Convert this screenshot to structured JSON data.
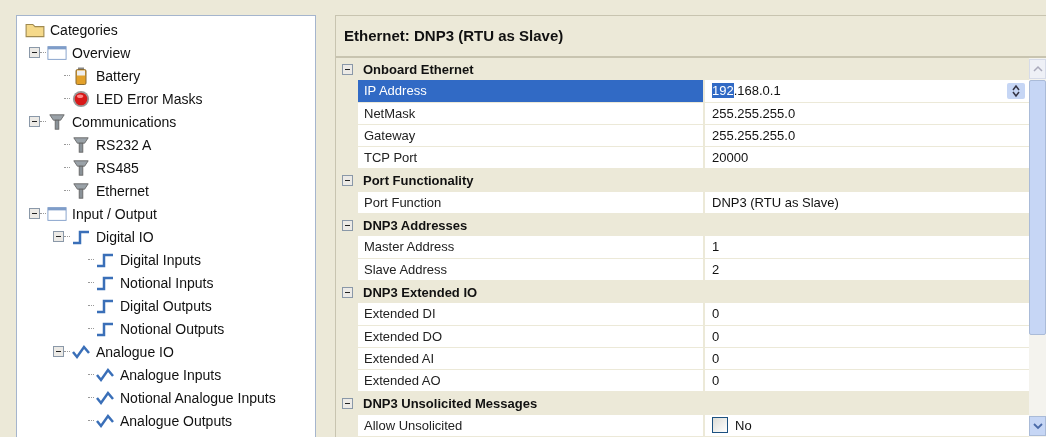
{
  "tree": {
    "label": "Categories",
    "kind": "folder",
    "children": [
      {
        "label": "Overview",
        "kind": "window",
        "expanded": true,
        "children": [
          {
            "label": "Battery",
            "kind": "battery"
          },
          {
            "label": "LED Error Masks",
            "kind": "led"
          }
        ]
      },
      {
        "label": "Communications",
        "kind": "connector",
        "expanded": true,
        "children": [
          {
            "label": "RS232 A",
            "kind": "connector"
          },
          {
            "label": "RS485",
            "kind": "connector"
          },
          {
            "label": "Ethernet",
            "kind": "connector"
          }
        ]
      },
      {
        "label": "Input / Output",
        "kind": "window",
        "expanded": true,
        "children": [
          {
            "label": "Digital IO",
            "kind": "digital",
            "expanded": true,
            "children": [
              {
                "label": "Digital Inputs",
                "kind": "digital"
              },
              {
                "label": "Notional Inputs",
                "kind": "digital"
              },
              {
                "label": "Digital Outputs",
                "kind": "digital"
              },
              {
                "label": "Notional Outputs",
                "kind": "digital"
              }
            ]
          },
          {
            "label": "Analogue IO",
            "kind": "analogue",
            "expanded": true,
            "children": [
              {
                "label": "Analogue Inputs",
                "kind": "analogue"
              },
              {
                "label": "Notional Analogue Inputs",
                "kind": "analogue"
              },
              {
                "label": "Analogue Outputs",
                "kind": "analogue"
              }
            ]
          }
        ]
      }
    ]
  },
  "panel": {
    "title": "Ethernet: DNP3 (RTU as Slave)",
    "sections": [
      {
        "title": "Onboard Ethernet",
        "expanded": true,
        "rows": [
          {
            "label": "IP Address",
            "kind": "spin",
            "selected": true,
            "value_highlighted": "192",
            "value": ".168.0.1"
          },
          {
            "label": "NetMask",
            "kind": "text",
            "selected": false,
            "value": "255.255.255.0"
          },
          {
            "label": "Gateway",
            "kind": "text",
            "selected": false,
            "value": "255.255.255.0"
          },
          {
            "label": "TCP Port",
            "kind": "text",
            "selected": false,
            "value": "20000"
          }
        ]
      },
      {
        "title": "Port Functionality",
        "expanded": true,
        "rows": [
          {
            "label": "Port Function",
            "kind": "text",
            "selected": false,
            "value": "DNP3 (RTU as Slave)"
          }
        ]
      },
      {
        "title": "DNP3 Addresses",
        "expanded": true,
        "rows": [
          {
            "label": "Master Address",
            "kind": "text",
            "selected": false,
            "value": "1"
          },
          {
            "label": "Slave Address",
            "kind": "text",
            "selected": false,
            "value": "2"
          }
        ]
      },
      {
        "title": "DNP3 Extended IO",
        "expanded": true,
        "rows": [
          {
            "label": "Extended DI",
            "kind": "text",
            "selected": false,
            "value": "0"
          },
          {
            "label": "Extended DO",
            "kind": "text",
            "selected": false,
            "value": "0"
          },
          {
            "label": "Extended AI",
            "kind": "text",
            "selected": false,
            "value": "0"
          },
          {
            "label": "Extended AO",
            "kind": "text",
            "selected": false,
            "value": "0"
          }
        ]
      },
      {
        "title": "DNP3 Unsolicited Messages",
        "expanded": true,
        "rows": [
          {
            "label": "Allow Unsolicited",
            "kind": "checkbox",
            "selected": false,
            "checked": false,
            "value": "No"
          }
        ]
      }
    ]
  }
}
